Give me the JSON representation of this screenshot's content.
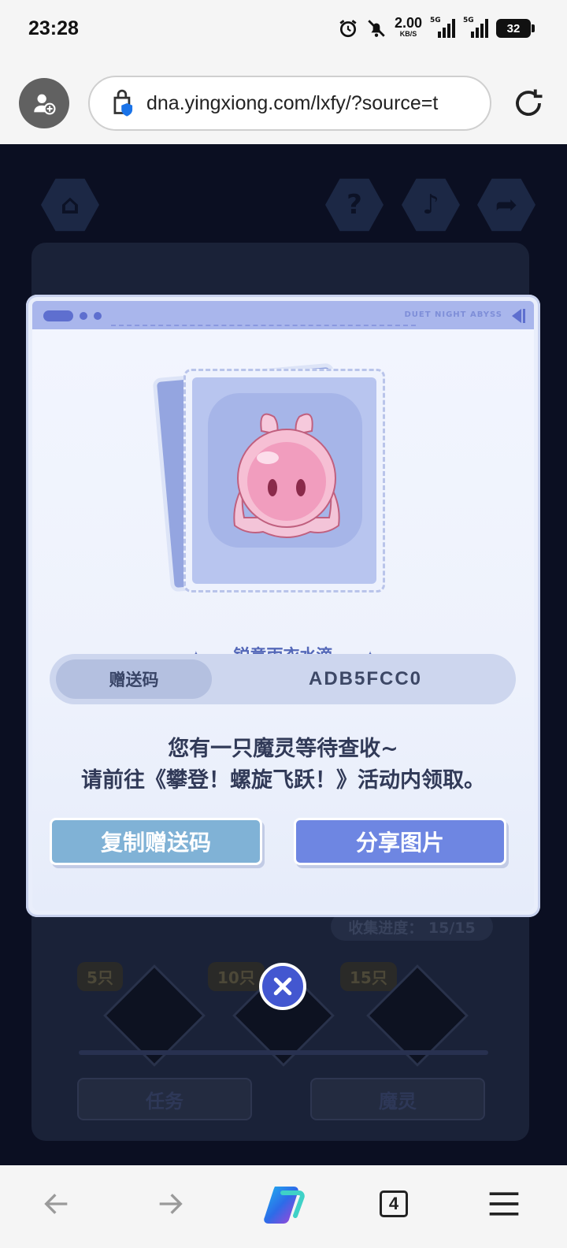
{
  "status_bar": {
    "time": "23:28",
    "net_speed": "2.00",
    "net_unit": "KB/S",
    "sim1_label": "5G",
    "sim2_label": "5G",
    "battery": "32"
  },
  "browser": {
    "url": "dna.yingxiong.com/lxfy/?source=t"
  },
  "game": {
    "progress_label": "收集进度： 15/15",
    "milestones": [
      "5只",
      "10只",
      "15只"
    ],
    "tabs": [
      "任务",
      "魔灵"
    ]
  },
  "modal": {
    "header_tag": "DUET NIGHT ABYSS",
    "item_name": "锐意雨衣水滴",
    "code_label": "赠送码",
    "code_value": "ADB5FCC0",
    "message_line1": "您有一只魔灵等待查收~",
    "message_line2": "请前往《攀登！螺旋飞跃！》活动内领取。",
    "copy_button": "复制赠送码",
    "share_button": "分享图片"
  },
  "bottom_nav": {
    "tab_count": "4"
  },
  "colors": {
    "modal_accent": "#5e6fcf",
    "copy_button": "#80b2d6",
    "share_button": "#6e86e2",
    "close_button": "#4357d0"
  }
}
